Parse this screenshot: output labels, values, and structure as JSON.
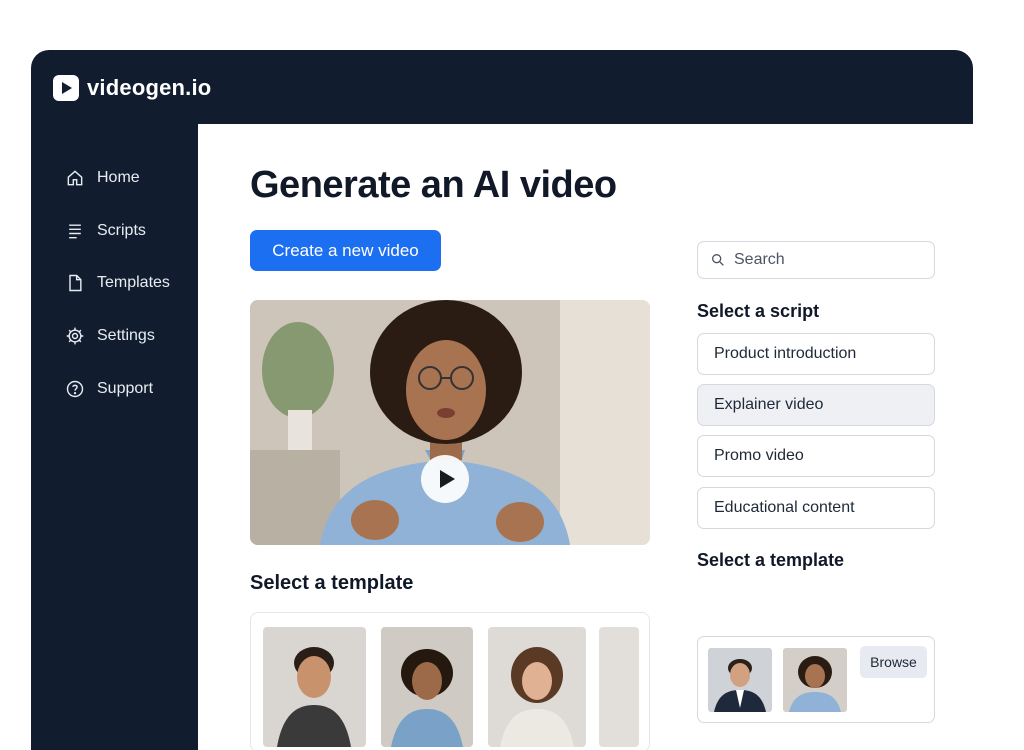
{
  "app": {
    "name": "videogen.io"
  },
  "sidebar": {
    "items": [
      {
        "label": "Home",
        "icon": "home-icon"
      },
      {
        "label": "Scripts",
        "icon": "list-icon"
      },
      {
        "label": "Templates",
        "icon": "file-icon"
      },
      {
        "label": "Settings",
        "icon": "gear-icon"
      },
      {
        "label": "Support",
        "icon": "help-icon"
      }
    ]
  },
  "main": {
    "title": "Generate an AI video",
    "create_button": "Create a new video",
    "template_section_title": "Select a template"
  },
  "right_panel": {
    "search_placeholder": "Search",
    "script_section_title": "Select a script",
    "scripts": [
      {
        "label": "Product introduction",
        "selected": false
      },
      {
        "label": "Explainer video",
        "selected": true
      },
      {
        "label": "Promo video",
        "selected": false
      },
      {
        "label": "Educational content",
        "selected": false
      }
    ],
    "template_section_title": "Select a template",
    "browse_button": "Browse"
  },
  "colors": {
    "sidebar_bg": "#111d2e",
    "accent": "#1d6ff2",
    "selected_item_bg": "#eef0f3"
  }
}
